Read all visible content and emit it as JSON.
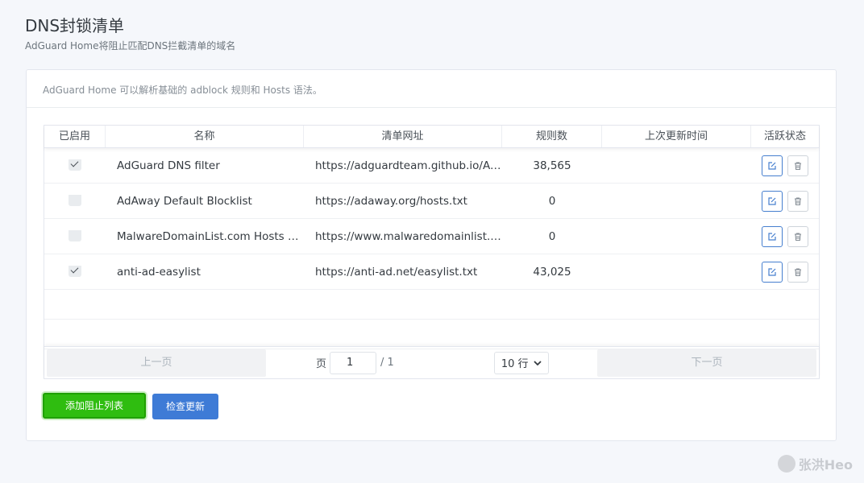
{
  "page": {
    "title": "DNS封锁清单",
    "subtitle": "AdGuard Home将阻止匹配DNS拦截清单的域名"
  },
  "card": {
    "info": "AdGuard Home 可以解析基础的 adblock 规则和 Hosts 语法。"
  },
  "table": {
    "headers": [
      "已启用",
      "名称",
      "清单网址",
      "规则数",
      "上次更新时间",
      "活跃状态"
    ],
    "rows": [
      {
        "enabled": true,
        "name": "AdGuard DNS filter",
        "url": "https://adguardteam.github.io/AdGuardSDNS/Filters/filter.txt",
        "rules": "38,565",
        "last_updated": ""
      },
      {
        "enabled": false,
        "name": "AdAway Default Blocklist",
        "url": "https://adaway.org/hosts.txt",
        "rules": "0",
        "last_updated": ""
      },
      {
        "enabled": false,
        "name": "MalwareDomainList.com Hosts List",
        "url": "https://www.malwaredomainlist.com/hostslist/hosts.txt",
        "rules": "0",
        "last_updated": ""
      },
      {
        "enabled": true,
        "name": "anti-ad-easylist",
        "url": "https://anti-ad.net/easylist.txt",
        "rules": "43,025",
        "last_updated": ""
      }
    ]
  },
  "pagination": {
    "prev": "上一页",
    "page_label": "页",
    "page_value": "1",
    "total": "/ 1",
    "rows_per_page": "10 行",
    "next": "下一页"
  },
  "buttons": {
    "add": "添加阻止列表",
    "check": "检查更新"
  },
  "watermark": "张洪Heo",
  "colors": {
    "edit_border": "#467fcf",
    "add_button": "#2fbd10",
    "check_button": "#3e7bd6"
  }
}
